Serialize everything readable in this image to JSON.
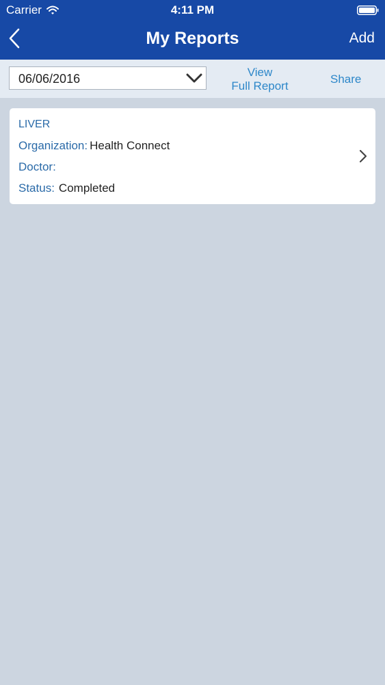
{
  "status_bar": {
    "carrier": "Carrier",
    "time": "4:11 PM",
    "icons": [
      "wifi-icon",
      "battery-icon"
    ]
  },
  "nav": {
    "title": "My Reports",
    "back_icon": "back-chevron-icon",
    "add_label": "Add"
  },
  "toolbar": {
    "date_value": "06/06/2016",
    "view_label_line1": "View",
    "view_label_line2": "Full Report",
    "share_label": "Share"
  },
  "reports": [
    {
      "title": "LIVER",
      "organization_label": "Organization:",
      "organization_value": "Health Connect",
      "doctor_label": "Doctor:",
      "doctor_value": "",
      "status_label": "Status:",
      "status_value": "Completed"
    }
  ],
  "colors": {
    "header_bg": "#1749a6",
    "toolbar_bg": "#e4ebf3",
    "page_bg": "#ccd5e0",
    "link": "#2d87c9",
    "label": "#2a6aa8"
  }
}
